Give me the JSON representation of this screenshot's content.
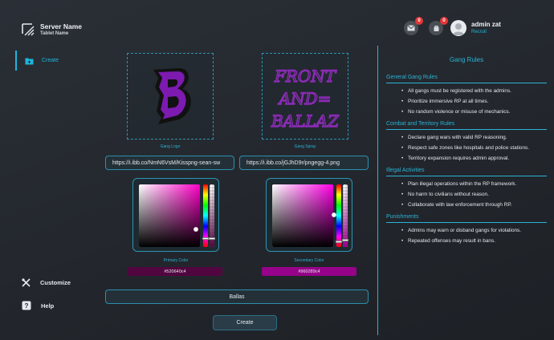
{
  "brand": {
    "name": "Server Name",
    "subtitle": "Tablet Name"
  },
  "header": {
    "mail_count": "0",
    "cart_count": "0",
    "user_name": "admin zat",
    "user_role": "Recruit"
  },
  "sidebar": {
    "create_label": "Create",
    "customize_label": "Customize",
    "help_label": "Help"
  },
  "form": {
    "logo_caption": "Gang Logo",
    "spray_caption": "Gang Spray",
    "logo_url": "https://i.ibb.co/NmN6VsM/Kisspng-sean-sw",
    "spray_url": "https://i.ibb.co/jGJhD9r/pngegg-4.png",
    "primary_caption": "Primary Color",
    "secondary_caption": "Secondary Color",
    "primary_color_value": "#520640c4",
    "secondary_color_value": "#960289c4",
    "primary_color": "#520640",
    "secondary_color": "#960289",
    "primary_hue": "#ff00c8",
    "secondary_hue": "#ff00e6",
    "gang_name": "Ballas",
    "create_button": "Create",
    "spray_text": "FRONT AND BALLAZ",
    "logo_letter": "B"
  },
  "rules": {
    "title": "Gang Rules",
    "sections": [
      {
        "title": "General Gang Rules",
        "items": [
          "All gangs must be registered with the admins.",
          "Prioritize immersive RP at all times.",
          "No random violence or misuse of mechanics."
        ]
      },
      {
        "title": "Combat and Territory Rules",
        "items": [
          "Declare gang wars with valid RP reasoning.",
          "Respect safe zones like hospitals and police stations.",
          "Territory expansion requires admin approval."
        ]
      },
      {
        "title": "Illegal Activities",
        "items": [
          "Plan illegal operations within the RP framework.",
          "No harm to civilians without reason.",
          "Collaborate with law enforcement through RP."
        ]
      },
      {
        "title": "Punishments",
        "items": [
          "Admins may warn or disband gangs for violations.",
          "Repeated offenses may result in bans."
        ]
      }
    ]
  },
  "icons": {
    "brand": "slash-square-logo-icon",
    "mail": "mail-icon",
    "cart": "cart-icon",
    "avatar": "user-avatar-icon",
    "create": "folder-plus-icon",
    "customize": "tools-icon",
    "help": "question-icon"
  }
}
